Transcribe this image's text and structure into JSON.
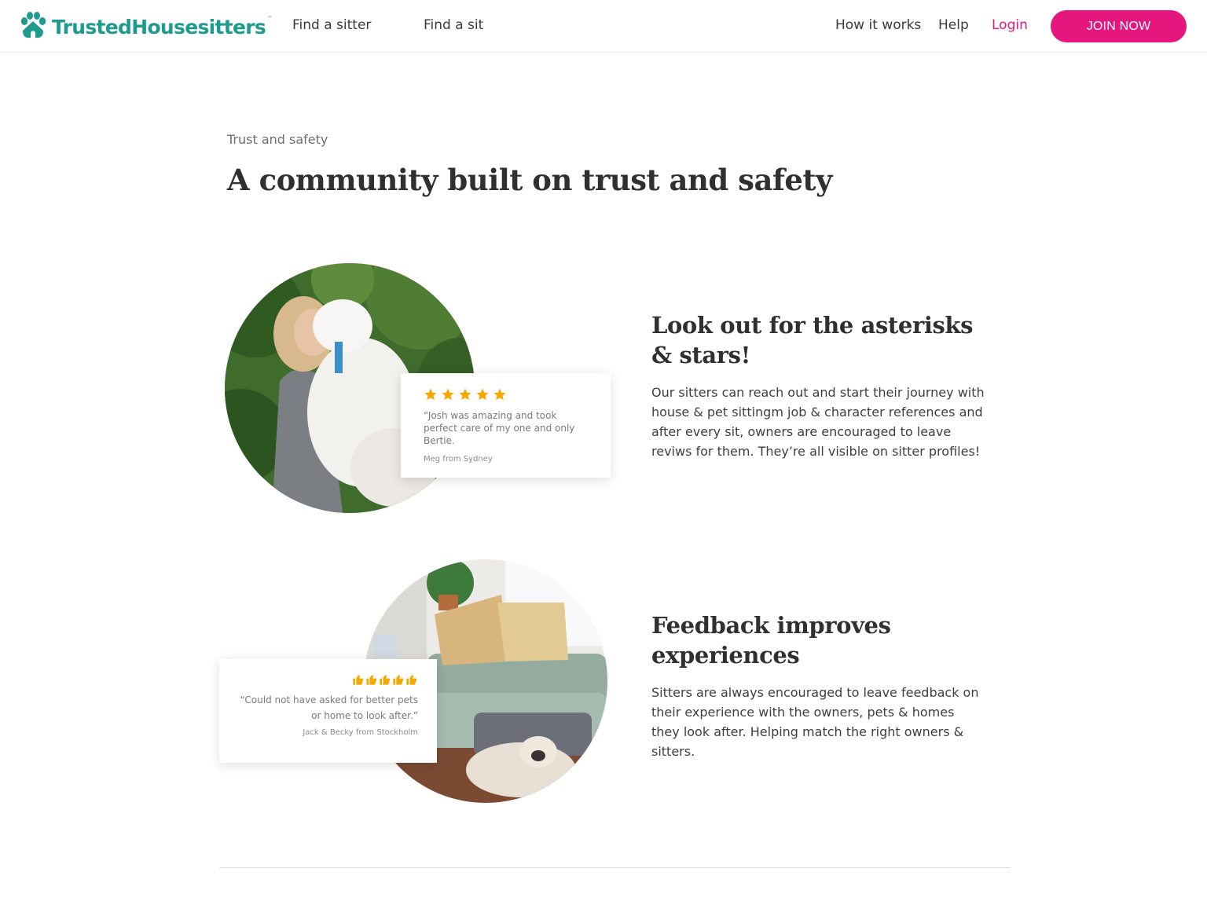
{
  "brand": {
    "name": "TrustedHousesitters",
    "tm": "™",
    "primary_color": "#1e9b8f",
    "accent_color": "#e5167e",
    "logo_icon": "paw-house-icon"
  },
  "nav": {
    "find_sitter": "Find a sitter",
    "find_sit": "Find a sit",
    "how_it_works": "How it works",
    "help": "Help",
    "login": "Login",
    "join": "JOIN NOW"
  },
  "intro": {
    "eyebrow": "Trust and safety",
    "title": "A community built on trust and safety"
  },
  "features": [
    {
      "image": "woman-hugging-white-dog-photo",
      "review": {
        "rating_icon": "star-icon",
        "rating": 5,
        "quote": "“Josh was amazing and took perfect care of my one and only Bertie.",
        "author": "Meg from Sydney"
      },
      "title": "Look out for the asterisks & stars!",
      "body": "Our sitters can reach out and start their journey with house & pet sittingm job & character references and after every sit, owners are encouraged to leave reviws for them. They’re all visible on sitter profiles!"
    },
    {
      "image": "living-room-with-french-bulldog-photo",
      "review": {
        "rating_icon": "thumbs-up-icon",
        "rating": 5,
        "quote": "“Could not have asked for better pets or home to look after.”",
        "author": "Jack & Becky from Stockholm"
      },
      "title": "Feedback improves experiences",
      "body": "Sitters are always encouraged to leave feedback on their experience with the owners, pets & homes they look after. Helping match the right owners & sitters."
    }
  ]
}
